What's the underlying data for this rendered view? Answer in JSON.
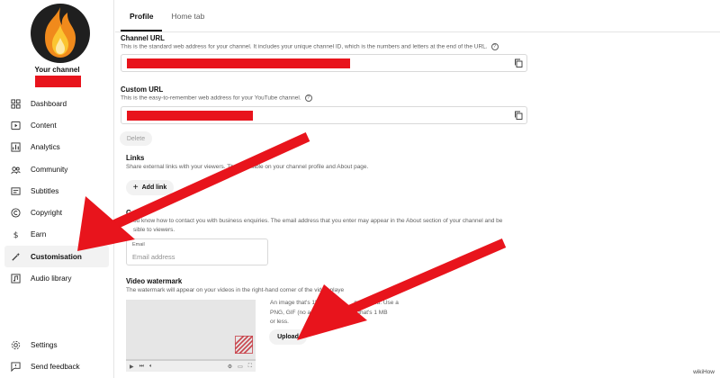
{
  "sidebar": {
    "channel_name": "Your channel",
    "items": [
      {
        "label": "Dashboard",
        "icon": "dashboard-icon"
      },
      {
        "label": "Content",
        "icon": "content-icon"
      },
      {
        "label": "Analytics",
        "icon": "analytics-icon"
      },
      {
        "label": "Community",
        "icon": "community-icon"
      },
      {
        "label": "Subtitles",
        "icon": "subtitles-icon"
      },
      {
        "label": "Copyright",
        "icon": "copyright-icon"
      },
      {
        "label": "Earn",
        "icon": "earn-icon"
      },
      {
        "label": "Customisation",
        "icon": "magic-wand-icon",
        "active": true
      },
      {
        "label": "Audio library",
        "icon": "audio-library-icon"
      }
    ],
    "bottom_items": [
      {
        "label": "Settings",
        "icon": "gear-icon"
      },
      {
        "label": "Send feedback",
        "icon": "feedback-icon"
      }
    ]
  },
  "tabs": [
    {
      "label": "Profile",
      "active": true
    },
    {
      "label": "Home tab",
      "active": false
    }
  ],
  "channel_url": {
    "title": "Channel URL",
    "description": "This is the standard web address for your channel. It includes your unique channel ID, which is the numbers and letters at the end of the URL."
  },
  "custom_url": {
    "title": "Custom URL",
    "description": "This is the easy-to-remember web address for your YouTube channel.",
    "delete_label": "Delete"
  },
  "links": {
    "title": "Links",
    "description": "Share external links with your viewers. The",
    "description_tail": "sible on your channel profile and About page.",
    "add_label": "Add link"
  },
  "contact": {
    "title": "Conta",
    "description": "ou know how to contact you with business enquiries. The email address that you enter may appear in the About section of your channel and be",
    "description2": "sible to viewers.",
    "email_label": "Email",
    "email_placeholder": "Email address"
  },
  "watermark": {
    "title": "Video watermark",
    "description": "The watermark will appear on your videos in the right-hand corner of the video playe",
    "info_line1": "An image that's 150 x 15",
    "info_line1_tail": "mmended. Use a",
    "info_line2": "PNG, GIF (no animatio",
    "info_line2_tail": "file that's 1 MB",
    "info_line3": "or less.",
    "upload_label": "Upload"
  },
  "footer": {
    "watermark_text": "wikiHow"
  },
  "colors": {
    "redaction": "#e8141c",
    "arrow": "#e8141c",
    "accent": "#0f0f0f"
  }
}
